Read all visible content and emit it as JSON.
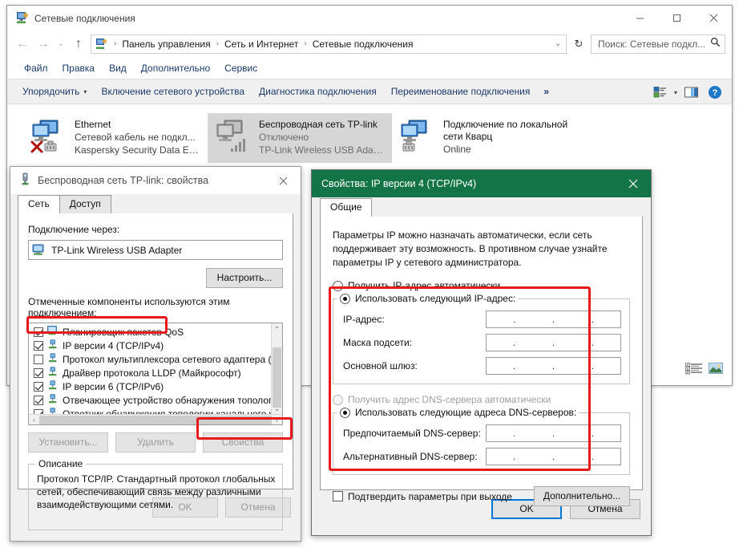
{
  "explorer": {
    "title": "Сетевые подключения",
    "icon": "network-connections-icon",
    "window_controls": {
      "minimize": "—",
      "maximize": "☐",
      "close": "✕"
    },
    "nav": {
      "back": "←",
      "forward": "→",
      "recent": "⌄",
      "up": "↑"
    },
    "breadcrumbs": [
      "Панель управления",
      "Сеть и Интернет",
      "Сетевые подключения"
    ],
    "breadcrumb_separator": "›",
    "address_dropdown": "⌄",
    "refresh": "↻",
    "search": {
      "value": "Поиск: Сетевые подкл...",
      "placeholder": "Поиск: Сетевые подключения",
      "icon": "search-icon"
    },
    "menubar": [
      "Файл",
      "Правка",
      "Вид",
      "Дополнительно",
      "Сервис"
    ],
    "toolbar": {
      "organize": "Упорядочить",
      "organize_caret": "▾",
      "items": [
        "Включение сетевого устройства",
        "Диагностика подключения",
        "Переименование подключения"
      ],
      "overflow": "»",
      "view_caret": "▾",
      "icons": [
        "change-view-icon",
        "preview-pane-icon",
        "help-icon"
      ],
      "help_glyph": "?"
    },
    "connections": [
      {
        "name": "Ethernet",
        "status": "Сетевой кабель не подкл...",
        "adapter": "Kaspersky Security Data Esc...",
        "selected": false,
        "disconnected": true,
        "icon": "ethernet-adapter-icon"
      },
      {
        "name": "Беспроводная сеть TP-link",
        "status": "Отключено",
        "adapter": "TP-Link Wireless USB Adap...",
        "selected": true,
        "disabled": true,
        "icon": "wireless-adapter-icon"
      },
      {
        "name": "Подключение по локальной сети Кварц",
        "status": "Online",
        "adapter": "",
        "selected": false,
        "icon": "lan-adapter-icon"
      }
    ],
    "status_views": [
      "details-view-icon",
      "large-icons-view-icon"
    ]
  },
  "adapter_dialog": {
    "title": "Беспроводная сеть TP-link: свойства",
    "icon": "usb-adapter-icon",
    "close": "✕",
    "tabs": [
      {
        "label": "Сеть",
        "active": true
      },
      {
        "label": "Доступ",
        "active": false
      }
    ],
    "connect_via_label": "Подключение через:",
    "adapter_name": "TP-Link Wireless USB Adapter",
    "adapter_icon": "network-adapter-icon",
    "configure_button": "Настроить...",
    "components_label": "Отмеченные компоненты используются этим подключением:",
    "components": [
      {
        "label": "Планировщик пакетов QoS",
        "checked": true,
        "icon": "qos-icon"
      },
      {
        "label": "IP версии 4 (TCP/IPv4)",
        "checked": true,
        "icon": "protocol-icon",
        "highlighted": true
      },
      {
        "label": "Протокол мультиплексора сетевого адаптера (Май",
        "checked": false,
        "icon": "protocol-icon"
      },
      {
        "label": "Драйвер протокола LLDP (Майкрософт)",
        "checked": true,
        "icon": "protocol-icon"
      },
      {
        "label": "IP версии 6 (TCP/IPv6)",
        "checked": true,
        "icon": "protocol-icon"
      },
      {
        "label": "Отвечающее устройство обнаружения топологии к",
        "checked": true,
        "icon": "protocol-icon"
      },
      {
        "label": "Ответчик обнаружения топологии канального уров",
        "checked": true,
        "icon": "protocol-icon"
      }
    ],
    "scroll_up": "⌃",
    "scroll_down": "⌄",
    "scroll_left": "‹",
    "scroll_right": "›",
    "buttons": {
      "install": "Установить...",
      "uninstall": "Удалить",
      "properties": "Свойства"
    },
    "description_title": "Описание",
    "description_text": "Протокол TCP/IP. Стандартный протокол глобальных сетей, обеспечивающий связь между различными взаимодействующими сетями.",
    "ok": "OK",
    "cancel": "Отмена"
  },
  "ip_dialog": {
    "title": "Свойства: IP версии 4 (TCP/IPv4)",
    "title_bar_color": "#137547",
    "close": "✕",
    "tabs": [
      {
        "label": "Общие",
        "active": true
      }
    ],
    "intro": "Параметры IP можно назначать автоматически, если сеть поддерживает эту возможность. В противном случае узнайте параметры IP у сетевого администратора.",
    "auto_ip_label": "Получить IP-адрес автоматически",
    "auto_ip_selected": false,
    "manual_ip_label": "Использовать следующий IP-адрес:",
    "manual_ip_selected": true,
    "ip_fields": [
      {
        "label": "IP-адрес:",
        "value": ""
      },
      {
        "label": "Маска подсети:",
        "value": ""
      },
      {
        "label": "Основной шлюз:",
        "value": ""
      }
    ],
    "auto_dns_label": "Получить адрес DNS-сервера автоматически",
    "auto_dns_selected": false,
    "auto_dns_disabled": true,
    "manual_dns_label": "Использовать следующие адреса DNS-серверов:",
    "manual_dns_selected": true,
    "dns_fields": [
      {
        "label": "Предпочитаемый DNS-сервер:",
        "value": ""
      },
      {
        "label": "Альтернативный DNS-сервер:",
        "value": ""
      }
    ],
    "validate_label": "Подтвердить параметры при выходе",
    "validate_checked": false,
    "advanced_button": "Дополнительно...",
    "ok": "OK",
    "cancel": "Отмена",
    "ip_separator": "."
  },
  "annotations": {
    "highlight_color": "#e8191a",
    "boxes": [
      "ipv4-list-item-highlight",
      "properties-button-highlight",
      "ip-settings-highlight"
    ]
  }
}
